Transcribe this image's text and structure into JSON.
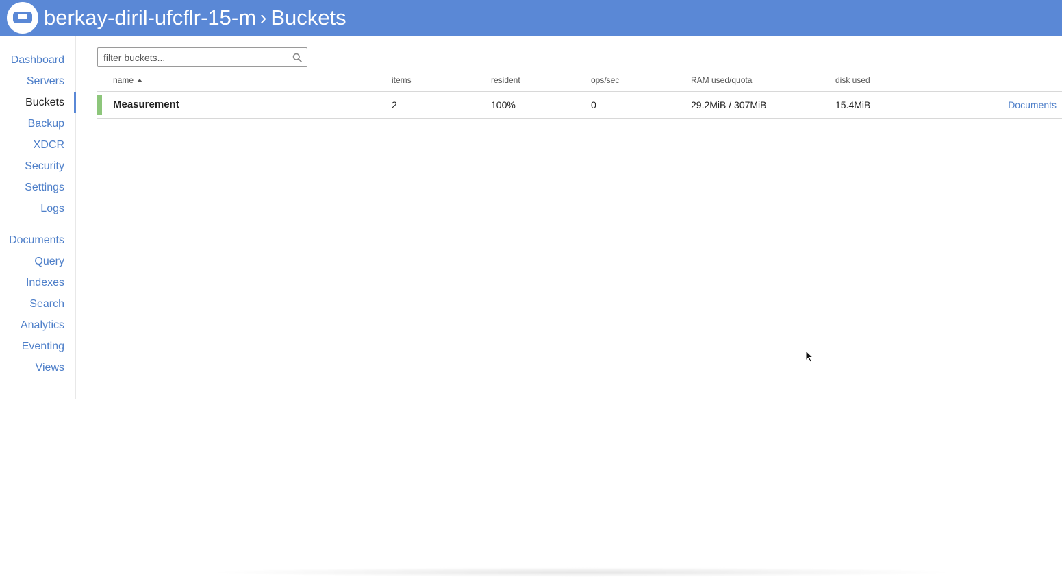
{
  "header": {
    "cluster_name": "berkay-diril-ufcflr-15-m",
    "separator": "›",
    "page_title": "Buckets"
  },
  "sidebar": {
    "items": [
      {
        "label": "Dashboard"
      },
      {
        "label": "Servers"
      },
      {
        "label": "Buckets",
        "active": true
      },
      {
        "label": "Backup"
      },
      {
        "label": "XDCR"
      },
      {
        "label": "Security"
      },
      {
        "label": "Settings"
      },
      {
        "label": "Logs"
      },
      {
        "label": "Documents"
      },
      {
        "label": "Query"
      },
      {
        "label": "Indexes"
      },
      {
        "label": "Search"
      },
      {
        "label": "Analytics"
      },
      {
        "label": "Eventing"
      },
      {
        "label": "Views"
      }
    ]
  },
  "filter": {
    "placeholder": "filter buckets...",
    "icon": "search-icon"
  },
  "table": {
    "columns": [
      "name",
      "items",
      "resident",
      "ops/sec",
      "RAM used/quota",
      "disk used"
    ],
    "sort": {
      "column": "name",
      "direction": "ascending"
    },
    "rows": [
      {
        "name": "Measurement",
        "items": "2",
        "resident": "100%",
        "ops_sec": "0",
        "ram": "29.2MiB / 307MiB",
        "disk": "15.4MiB",
        "action": "Documents",
        "status": "healthy"
      }
    ]
  },
  "colors": {
    "header_bg": "#5a88d6",
    "link": "#4e7fc9",
    "status_healthy": "#8dc67b"
  }
}
